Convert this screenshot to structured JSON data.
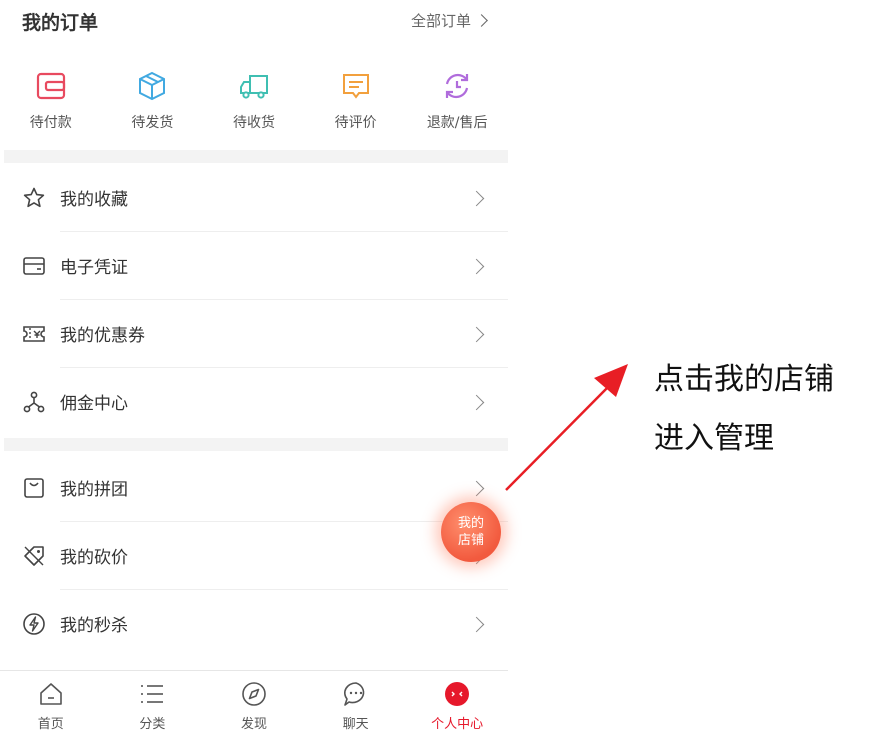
{
  "orders": {
    "title": "我的订单",
    "all_label": "全部订单",
    "items": [
      {
        "label": "待付款",
        "icon": "wallet-icon",
        "color": "#e84a5f"
      },
      {
        "label": "待发货",
        "icon": "package-icon",
        "color": "#41a9e1"
      },
      {
        "label": "待收货",
        "icon": "truck-icon",
        "color": "#3fbfb2"
      },
      {
        "label": "待评价",
        "icon": "comment-icon",
        "color": "#f2a03d"
      },
      {
        "label": "退款/售后",
        "icon": "refund-icon",
        "color": "#b06cdc"
      }
    ]
  },
  "menu": {
    "items": [
      {
        "label": "我的收藏",
        "icon": "star-icon"
      },
      {
        "label": "电子凭证",
        "icon": "card-icon"
      },
      {
        "label": "我的优惠券",
        "icon": "coupon-icon"
      },
      {
        "label": "佣金中心",
        "icon": "network-icon"
      },
      {
        "label": "我的拼团",
        "icon": "bag-icon"
      },
      {
        "label": "我的砍价",
        "icon": "tag-icon"
      },
      {
        "label": "我的秒杀",
        "icon": "lightning-icon"
      }
    ]
  },
  "float_button": {
    "line1": "我的",
    "line2": "店铺",
    "color": "#f25a3e"
  },
  "tabbar": {
    "items": [
      {
        "label": "首页",
        "icon": "home-icon"
      },
      {
        "label": "分类",
        "icon": "list-icon"
      },
      {
        "label": "发现",
        "icon": "compass-icon"
      },
      {
        "label": "聊天",
        "icon": "chat-icon"
      },
      {
        "label": "个人中心",
        "icon": "profile-icon"
      }
    ],
    "active_color": "#e6182b"
  },
  "annotation": {
    "line1": "点击我的店铺",
    "line2": "进入管理",
    "arrow_color": "#e81e25"
  }
}
